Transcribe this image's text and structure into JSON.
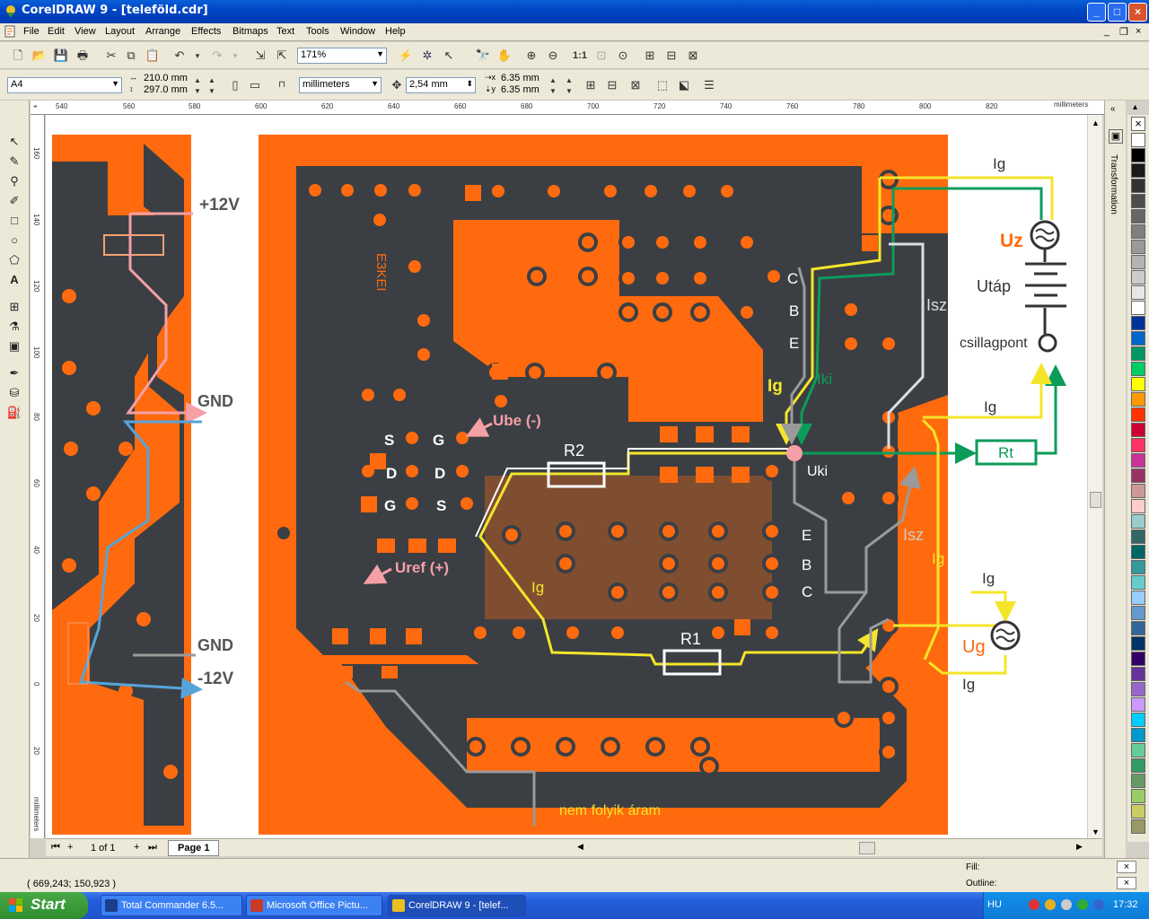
{
  "window": {
    "title": "CorelDRAW 9 - [teleföld.cdr]",
    "minimize": "_",
    "maximize": "□",
    "close": "×"
  },
  "menu": [
    "File",
    "Edit",
    "View",
    "Layout",
    "Arrange",
    "Effects",
    "Bitmaps",
    "Text",
    "Tools",
    "Window",
    "Help"
  ],
  "standard_toolbar": {
    "zoom_value": "171%"
  },
  "property_bar": {
    "paper_size": "A4",
    "width": "210.0 mm",
    "height": "297.0 mm",
    "units": "millimeters",
    "nudge": "2,54 mm",
    "dup_x": "6.35 mm",
    "dup_y": "6.35 mm"
  },
  "ruler": {
    "h_ticks": [
      "540",
      "560",
      "580",
      "600",
      "620",
      "640",
      "660",
      "680",
      "700",
      "720",
      "740",
      "760",
      "780",
      "800",
      "820"
    ],
    "h_unit": "millimeters",
    "v_ticks": [
      "160",
      "140",
      "120",
      "100",
      "80",
      "60",
      "40",
      "20",
      "0",
      "20"
    ],
    "v_unit": "millimeters"
  },
  "drawing": {
    "left_labels": {
      "plus12": "+12V",
      "gnd_top": "GND",
      "gnd_bottom": "GND",
      "minus12": "-12V"
    },
    "chip_text": "E3KEI",
    "pins_left": [
      "S",
      "D",
      "G"
    ],
    "pins_right": [
      "G",
      "D",
      "S"
    ],
    "ube": "Ube (-)",
    "uref": "Uref (+)",
    "r2": "R2",
    "r1": "R1",
    "ig": "Ig",
    "ig_bold": "Ig",
    "iki": "Iki",
    "isz": "Isz",
    "cbe_top": [
      "C",
      "B",
      "E"
    ],
    "ebc_bottom": [
      "E",
      "B",
      "C"
    ],
    "uki": "Uki",
    "uz": "Uz",
    "utap": "Utáp",
    "csillagpont": "csillagpont",
    "rt": "Rt",
    "ug": "Ug",
    "nem_folyik": "nem folyik áram"
  },
  "pagebar": {
    "page_count": "1 of 1",
    "page_tab": "Page 1"
  },
  "status": {
    "coords": "( 669,243; 150,923 )",
    "fill_label": "Fill:",
    "outline_label": "Outline:"
  },
  "taskbar": {
    "start": "Start",
    "tasks": [
      "Total Commander 6.5...",
      "Microsoft Office Pictu...",
      "CorelDRAW 9 - [telef..."
    ],
    "lang": "HU",
    "clock": "17:32"
  },
  "palette_colors": [
    "#ffffff",
    "#000000",
    "#1a1a1a",
    "#333333",
    "#4d4d4d",
    "#666666",
    "#808080",
    "#999999",
    "#b3b3b3",
    "#cccccc",
    "#e6e6e6",
    "#ffffff",
    "#003399",
    "#0066cc",
    "#009966",
    "#00cc66",
    "#ffff00",
    "#ff9900",
    "#ff3300",
    "#cc0033",
    "#ff3366",
    "#cc3399",
    "#993366",
    "#cc9999",
    "#ffcccc",
    "#99cccc",
    "#336666",
    "#006666",
    "#339999",
    "#66cccc",
    "#99ccff",
    "#6699cc",
    "#336699",
    "#003366",
    "#330066",
    "#663399",
    "#9966cc",
    "#cc99ff",
    "#00ccff",
    "#0099cc",
    "#66cc99",
    "#339966",
    "#669966",
    "#99cc66",
    "#cccc66",
    "#999966"
  ],
  "colors": {
    "pcb_dark": "#3b3f44",
    "copper": "#ff6a0e",
    "yellow": "#f5e52a",
    "green": "#0c9c5a",
    "pink": "#f5a0a6",
    "grey": "#9a9a9a",
    "blue": "#58a4d8"
  }
}
